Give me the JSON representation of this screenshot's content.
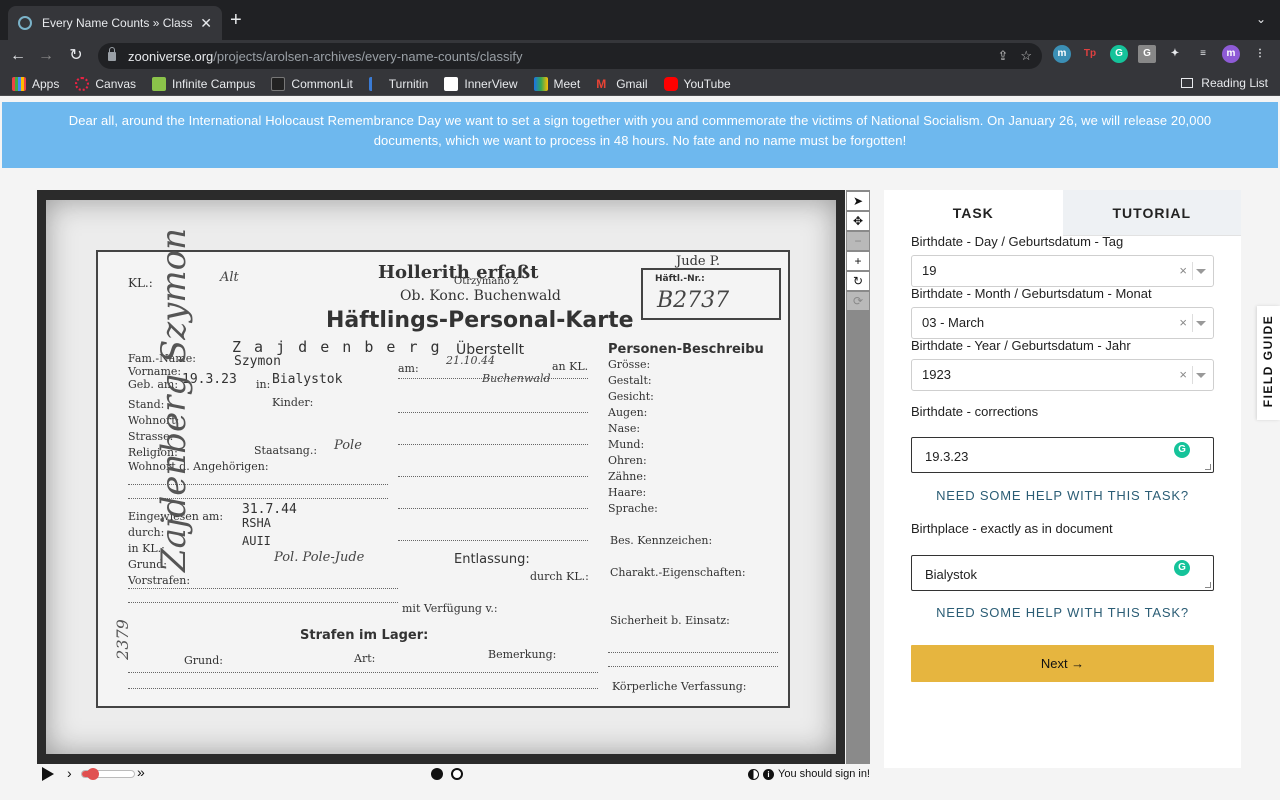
{
  "browser": {
    "tab_title": "Every Name Counts » Classify",
    "url_host": "zooniverse.org",
    "url_path": "/projects/arolsen-archives/every-name-counts/classify",
    "bookmarks": [
      "Apps",
      "Canvas",
      "Infinite Campus",
      "CommonLit",
      "Turnitin",
      "InnerView",
      "Meet",
      "Gmail",
      "YouTube"
    ],
    "reading_list": "Reading List",
    "profile_initial": "m"
  },
  "banner": {
    "text": "Dear all, around the International Holocaust Remembrance Day we want to set a sign together with you and commemorate the victims of National Socialism. On January 26, we will release 20,000 documents, which we want to process in 48 hours. No fate and no name must be forgotten!"
  },
  "document": {
    "kl": "KL.:",
    "kl_value": "Alt",
    "hollerith": "Hollerith erfaßt",
    "otrzymano": "Otrzymano z",
    "camp": "Ob. Konc. Buchenwald",
    "jude": "Jude P.",
    "haeftl_nr": "Häftl.-Nr.:",
    "number": "B2737",
    "title": "Häftlings-Personal-Karte",
    "surname_typed": "Z a j d e n b e r g",
    "ueberstellt": "Überstellt",
    "personen": "Personen-Beschreibu",
    "fam_name": "Fam.-Name:",
    "vorname": "Vorname:",
    "vorname_value": "Szymon",
    "geb_am": "Geb. am:",
    "geb_value": "19.3.23",
    "in_label": "in:",
    "birthplace": "Bialystok",
    "stand": "Stand:",
    "kinder": "Kinder:",
    "wohnort": "Wohnort:",
    "strasse": "Strasse:",
    "religion": "Religion:",
    "staatsang": "Staatsang.:",
    "staatsang_value": "Pole",
    "wohnort_ang": "Wohnort d. Angehörigen:",
    "eingewiesen": "Eingewiesen am:",
    "eingewiesen_value": "31.7.44",
    "durch": "durch:",
    "durch_value": "RSHA",
    "in_kl": "in KL.:",
    "in_kl_value": "AUII",
    "grund": "Grund:",
    "grund_value": "Pol. Pole-Jude",
    "vorstrafen": "Vorstrafen:",
    "entlassung": "Entlassung:",
    "durch_kl": "durch KL.:",
    "mit_verfuegung": "mit Verfügung v.:",
    "strafen": "Strafen im Lager:",
    "grund2": "Grund:",
    "art": "Art:",
    "bemerkung": "Bemerkung:",
    "am": "am:",
    "an_kl": "an KL.",
    "buchenwald_hand": "Buchenwald",
    "date_hand": "21.10.44",
    "groesse": "Grösse:",
    "gestalt": "Gestalt:",
    "gesicht": "Gesicht:",
    "augen": "Augen:",
    "nase": "Nase:",
    "mund": "Mund:",
    "ohren": "Ohren:",
    "zaehne": "Zähne:",
    "haare": "Haare:",
    "sprache": "Sprache:",
    "bes_kennzeichen": "Bes. Kennzeichen:",
    "charakt": "Charakt.-Eigenschaften:",
    "sicherheit": "Sicherheit b. Einsatz:",
    "koerperliche": "Körperliche Verfassung:",
    "side_name": "Zajdenberg Szymon",
    "side_number": "2379"
  },
  "player": {
    "signin_text": "You should sign in!",
    "slider_value": 0.22
  },
  "panel": {
    "tab_task": "TASK",
    "tab_tutorial": "TUTORIAL",
    "field_day_label": "Birthdate - Day / Geburtsdatum - Tag",
    "field_day_value": "19",
    "field_month_label": "Birthdate - Month / Geburtsdatum - Monat",
    "field_month_value": "03 - March",
    "field_year_label": "Birthdate - Year / Geburtsdatum - Jahr",
    "field_year_value": "1923",
    "corrections_label": "Birthdate - corrections",
    "corrections_value": "19.3.23",
    "help_1": "NEED SOME HELP WITH THIS TASK?",
    "birthplace_label": "Birthplace - exactly as in document",
    "birthplace_value": "Bialystok",
    "help_2": "NEED SOME HELP WITH THIS TASK?",
    "next_label": "Next →"
  },
  "field_guide": "FIELD GUIDE",
  "icons": {
    "clear": "×",
    "pointer": "pointer-icon",
    "move": "move-icon",
    "zoom_out": "zoom-out-icon",
    "zoom_in": "zoom-in-icon",
    "rotate": "rotate-icon",
    "reset": "reset-icon"
  }
}
